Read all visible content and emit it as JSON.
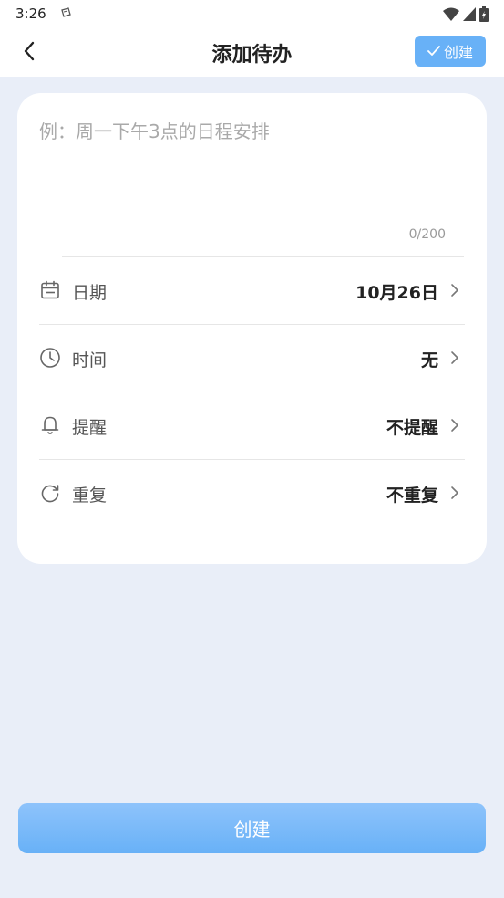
{
  "status_bar": {
    "time": "3:26",
    "icons": [
      "notification-icon",
      "wifi-icon",
      "signal-icon",
      "battery-icon"
    ]
  },
  "navbar": {
    "title": "添加待办",
    "back_icon": "chevron-left-icon",
    "create_label": "创建",
    "create_icon": "check-icon"
  },
  "form": {
    "placeholder": "例：周一下午3点的日程安排",
    "value": "",
    "counter": "0/200",
    "rows": [
      {
        "icon": "calendar-icon",
        "label": "日期",
        "value": "10月26日"
      },
      {
        "icon": "clock-icon",
        "label": "时间",
        "value": "无"
      },
      {
        "icon": "bell-icon",
        "label": "提醒",
        "value": "不提醒"
      },
      {
        "icon": "repeat-icon",
        "label": "重复",
        "value": "不重复"
      }
    ]
  },
  "footer": {
    "create_label": "创建"
  },
  "colors": {
    "background": "#e9eef8",
    "accent": "#68b1f7",
    "card": "#ffffff"
  }
}
